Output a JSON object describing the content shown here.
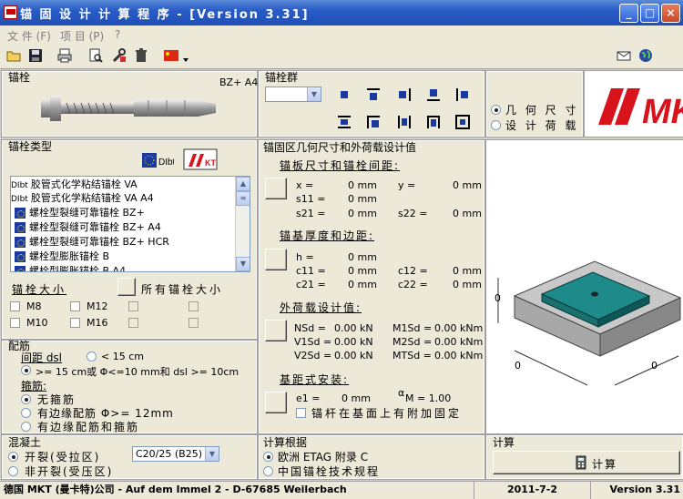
{
  "window": {
    "title": "锚 固 设 计 计 算 程 序 - [Version 3.31]",
    "min": "_",
    "max": "□",
    "close": "×"
  },
  "menu": [
    "文 件 (F)",
    "项 目 (P)",
    "?"
  ],
  "anchor_panel": {
    "title": "锚栓",
    "model": "BZ+ A4"
  },
  "group_panel": {
    "title": "锚栓群",
    "radio_geometry": "几 何 尺 寸",
    "radio_load": "设 计 荷 载"
  },
  "logo": "MKT",
  "type_panel": {
    "title": "锚栓类型",
    "items": [
      {
        "prefix": "DIbt",
        "label": "胶管式化学粘结锚栓 VA"
      },
      {
        "prefix": "DIbt",
        "label": "胶管式化学粘结锚栓 VA A4"
      },
      {
        "prefix": "eu",
        "label": "螺栓型裂缝可靠锚栓 BZ+"
      },
      {
        "prefix": "eu",
        "label": "螺栓型裂缝可靠锚栓 BZ+ A4"
      },
      {
        "prefix": "eu",
        "label": "螺栓型裂缝可靠锚栓 BZ+ HCR"
      },
      {
        "prefix": "eu",
        "label": "螺栓型膨胀锚栓 B"
      },
      {
        "prefix": "eu",
        "label": "螺栓型膨胀锚栓 B A4"
      }
    ],
    "size_title": "锚栓大小",
    "all_sizes": "所有锚栓大小",
    "sizes": [
      "M8",
      "M12",
      "M10",
      "M16"
    ]
  },
  "rebar_panel": {
    "title": "配筋",
    "spacing_label": "间距 dsl",
    "spacing_lt": "< 15 cm",
    "spacing_ge": ">= 15 cm或 Φ<=10 mm和 dsl >= 10cm",
    "stirrup_label": "箍筋:",
    "opt_none": "无箍筋",
    "opt_edge": "有边缘配筋 Φ>= 12mm",
    "opt_edge_stirrup": "有边缘配筋和箍筋"
  },
  "concrete_panel": {
    "title": "混凝土",
    "cracked": "开裂(受拉区)",
    "uncracked": "非开裂(受压区)",
    "grade": "C20/25 (B25)"
  },
  "geometry_panel": {
    "title": "锚固区几何尺寸和外荷载设计值",
    "plate_heading": "锚板尺寸和锚栓间距:",
    "x": "x =",
    "x_val": "0 mm",
    "y": "y =",
    "y_val": "0 mm",
    "s11": "s11 =",
    "s11_val": "0 mm",
    "s21": "s21 =",
    "s21_val": "0 mm",
    "s22": "s22 =",
    "s22_val": "0 mm",
    "base_heading": "锚基厚度和边距:",
    "h": "h =",
    "h_val": "0 mm",
    "c11": "c11 =",
    "c11_val": "0 mm",
    "c12": "c12 =",
    "c12_val": "0 mm",
    "c21": "c21 =",
    "c21_val": "0 mm",
    "c22": "c22 =",
    "c22_val": "0 mm",
    "load_heading": "外荷载设计值:",
    "NSd": "NSd =",
    "NSd_val": "0.00 kN",
    "M1Sd": "M1Sd =",
    "M1Sd_val": "0.00 kNm",
    "V1Sd": "V1Sd =",
    "V1Sd_val": "0.00 kN",
    "M2Sd": "M2Sd =",
    "M2Sd_val": "0.00 kNm",
    "V2Sd": "V2Sd =",
    "V2Sd_val": "0.00 kN",
    "MTSd": "MTSd =",
    "MTSd_val": "0.00 kNm",
    "install_heading": "基距式安装:",
    "e1": "e1 =",
    "e1_val": "0 mm",
    "alpha": "α",
    "alpha_m": "M = 1.00",
    "fixed_check": "锚杆在基面上有附加固定"
  },
  "basis_panel": {
    "title": "计算根据",
    "opt_etag": "欧洲 ETAG 附录 C",
    "opt_cn": "中国锚栓技术规程"
  },
  "calc_panel": {
    "title": "计算",
    "button": "计算"
  },
  "preview": {
    "dim_left": "0",
    "dim_bottom1": "0",
    "dim_bottom2": "0"
  },
  "status": {
    "company": "德国 MKT (曼卡特)公司 - Auf dem Immel 2 - D-67685 Weilerbach",
    "date": "2011-7-2",
    "version": "Version 3.31"
  }
}
